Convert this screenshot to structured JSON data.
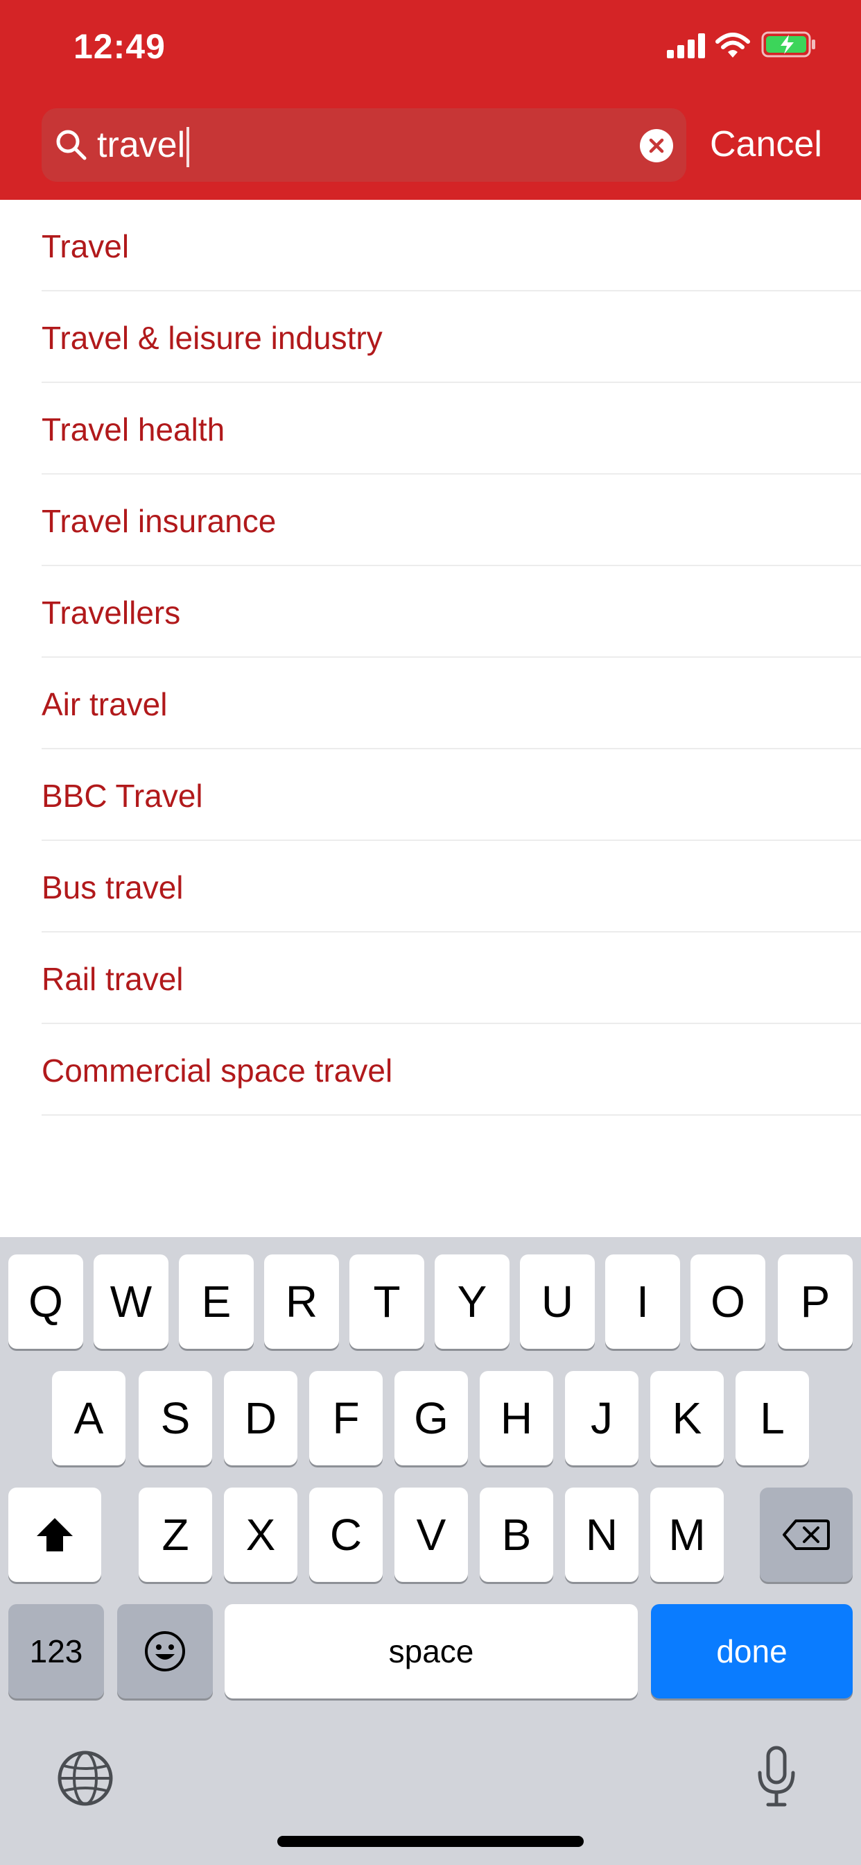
{
  "status_bar": {
    "time": "12:49"
  },
  "search": {
    "query": "travel",
    "cancel_label": "Cancel"
  },
  "results": [
    {
      "label": "Travel"
    },
    {
      "label": "Travel & leisure industry"
    },
    {
      "label": "Travel health"
    },
    {
      "label": "Travel insurance"
    },
    {
      "label": "Travellers"
    },
    {
      "label": "Air travel"
    },
    {
      "label": "BBC Travel"
    },
    {
      "label": "Bus travel"
    },
    {
      "label": "Rail travel"
    },
    {
      "label": "Commercial space travel"
    }
  ],
  "keyboard": {
    "row1": [
      "Q",
      "W",
      "E",
      "R",
      "T",
      "Y",
      "U",
      "I",
      "O",
      "P"
    ],
    "row2": [
      "A",
      "S",
      "D",
      "F",
      "G",
      "H",
      "J",
      "K",
      "L"
    ],
    "row3": [
      "Z",
      "X",
      "C",
      "V",
      "B",
      "N",
      "M"
    ],
    "numbers_label": "123",
    "space_label": "space",
    "done_label": "done"
  },
  "colors": {
    "header": "#d42426",
    "result_text": "#b1191b",
    "done_key": "#0a7cff",
    "keyboard_bg": "#d2d4da"
  },
  "icons": [
    "search-icon",
    "clear-icon",
    "signal-icon",
    "wifi-icon",
    "battery-charging-icon",
    "shift-icon",
    "backspace-icon",
    "emoji-icon",
    "globe-icon",
    "microphone-icon"
  ]
}
